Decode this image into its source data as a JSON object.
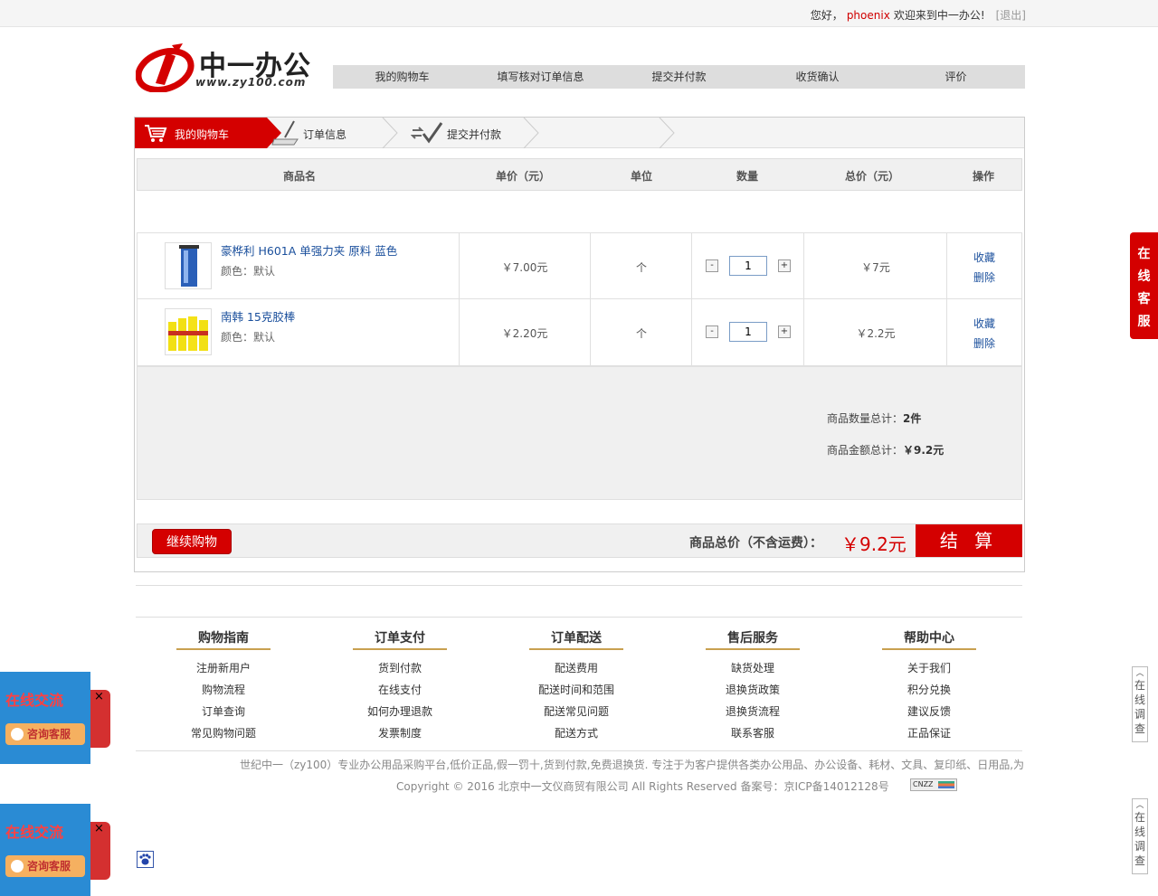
{
  "topbar": {
    "greeting": "您好，",
    "username": "phoenix",
    "welcome": "欢迎来到中一办公!",
    "logout": "[退出]"
  },
  "logo": {
    "name": "中一办公",
    "url": "www.zy100.com"
  },
  "stepnav": [
    "我的购物车",
    "填写核对订单信息",
    "提交并付款",
    "收货确认",
    "评价"
  ],
  "tabs": {
    "cart": "我的购物车",
    "order": "订单信息",
    "submit": "提交并付款"
  },
  "table": {
    "headers": [
      "商品名",
      "单价（元）",
      "单位",
      "数量",
      "总价（元）",
      "操作"
    ],
    "rows": [
      {
        "name": "豪桦利 H601A 单强力夹 原料 蓝色",
        "color": "颜色：默认",
        "price": "￥7.00元",
        "unit": "个",
        "qty": "1",
        "total": "￥7元",
        "fav": "收藏",
        "del": "删除"
      },
      {
        "name": "南韩 15克胶棒",
        "color": "颜色：默认",
        "price": "￥2.20元",
        "unit": "个",
        "qty": "1",
        "total": "￥2.2元",
        "fav": "收藏",
        "del": "删除"
      }
    ]
  },
  "summary": {
    "count_label": "商品数量总计：",
    "count": "2件",
    "amount_label": "商品金额总计：",
    "amount": "￥9.2元"
  },
  "bottombar": {
    "continue": "继续购物",
    "total_label": "商品总价（不含运费）：",
    "total": "￥9.2元",
    "checkout": "结 算"
  },
  "footer": {
    "columns": [
      {
        "title": "购物指南",
        "links": [
          "注册新用户",
          "购物流程",
          "订单查询",
          "常见购物问题"
        ]
      },
      {
        "title": "订单支付",
        "links": [
          "货到付款",
          "在线支付",
          "如何办理退款",
          "发票制度"
        ]
      },
      {
        "title": "订单配送",
        "links": [
          "配送费用",
          "配送时间和范围",
          "配送常见问题",
          "配送方式"
        ]
      },
      {
        "title": "售后服务",
        "links": [
          "缺货处理",
          "退换货政策",
          "退换货流程",
          "联系客服"
        ]
      },
      {
        "title": "帮助中心",
        "links": [
          "关于我们",
          "积分兑换",
          "建议反馈",
          "正品保证"
        ]
      }
    ],
    "description": "世纪中一（zy100）专业办公用品采购平台,低价正品,假一罚十,货到付款,免费退换货. 专注于为客户提供各类办公用品、办公设备、耗材、文具、复印纸、日用品,为",
    "copyright": "Copyright © 2016 北京中一文仪商贸有限公司 All Rights Reserved 备案号：京ICP备14012128号",
    "cnzz": "CNZZ"
  },
  "side": {
    "online_service": "在线客服",
    "survey": "在线调查",
    "chat_title": "在线交流",
    "chat_button": "咨询客服",
    "close": "×"
  }
}
